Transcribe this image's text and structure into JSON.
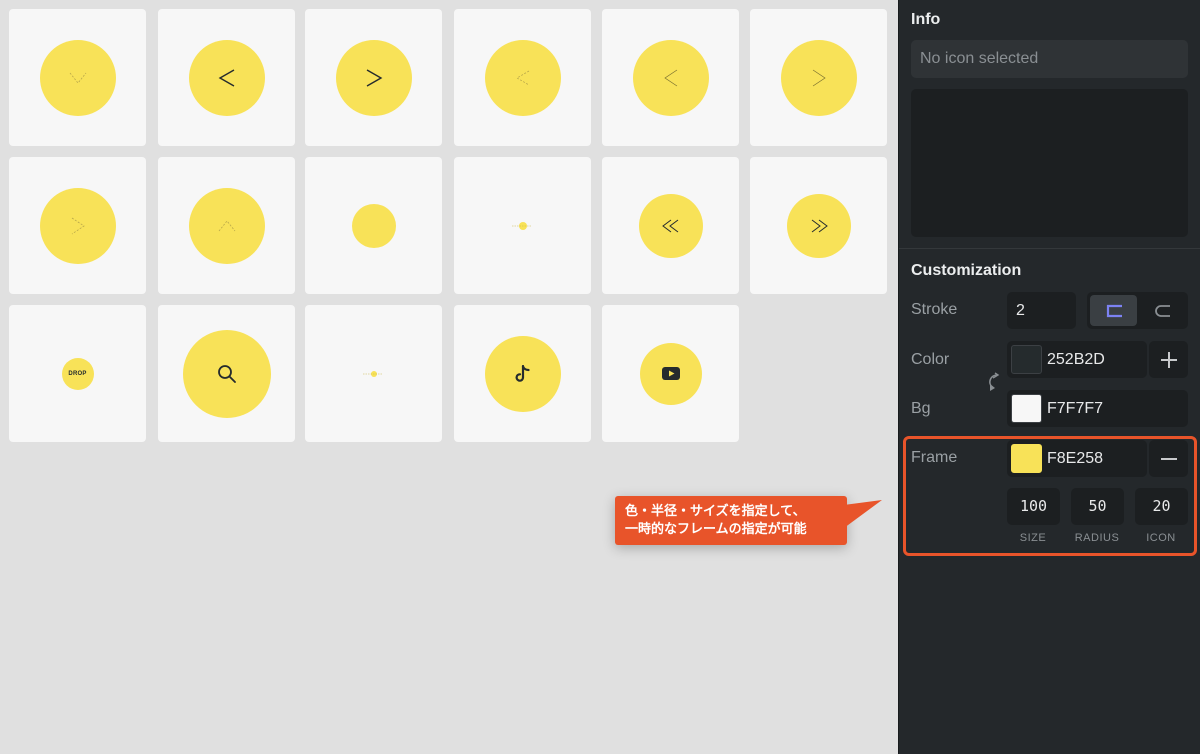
{
  "grid": {
    "tiles": [
      {
        "icon": "chevron-down-faint-icon",
        "size": "large"
      },
      {
        "icon": "chevron-left-icon",
        "size": "large"
      },
      {
        "icon": "chevron-right-icon",
        "size": "large"
      },
      {
        "icon": "chevron-left-faint-icon",
        "size": "large"
      },
      {
        "icon": "chevron-left-thin-icon",
        "size": "large"
      },
      {
        "icon": "chevron-right-thin-icon",
        "size": "large"
      },
      {
        "icon": "chevron-right-faint-icon",
        "size": "large"
      },
      {
        "icon": "chevron-up-faint-icon",
        "size": "large"
      },
      {
        "icon": "blank-circle-icon",
        "size": "small"
      },
      {
        "icon": "tiny-dot-icon",
        "size": "tiny"
      },
      {
        "icon": "double-chevron-left-icon",
        "size": "medium"
      },
      {
        "icon": "double-chevron-right-icon",
        "size": "medium"
      },
      {
        "icon": "drop-logo-icon",
        "size": "small"
      },
      {
        "icon": "search-icon",
        "size": "xlarge"
      },
      {
        "icon": "tiny-dot-icon",
        "size": "tiny"
      },
      {
        "icon": "tiktok-icon",
        "size": "large"
      },
      {
        "icon": "youtube-icon",
        "size": "medium"
      }
    ],
    "drop_logo_text": "DROP"
  },
  "sidebar": {
    "info_title": "Info",
    "info_placeholder": "No icon selected",
    "customization_title": "Customization",
    "stroke": {
      "label": "Stroke",
      "value": "2",
      "join_options": [
        "square-join-icon",
        "round-join-icon"
      ]
    },
    "color": {
      "label": "Color",
      "hex": "252B2D",
      "action_icon": "plus-icon"
    },
    "bg": {
      "label": "Bg",
      "hex": "F7F7F7"
    },
    "frame": {
      "label": "Frame",
      "hex": "F8E258",
      "action_icon": "minus-icon",
      "size_value": "100",
      "radius_value": "50",
      "icon_value": "20",
      "size_label": "SIZE",
      "radius_label": "RADIUS",
      "icon_label": "ICON"
    }
  },
  "callout": {
    "line1": "色・半径・サイズを指定して、",
    "line2": "一時的なフレームの指定が可能"
  },
  "colors": {
    "frame": "#F8E258",
    "stroke": "#252B2D",
    "tile_bg": "#F7F7F7",
    "accent": "#E8542A"
  }
}
